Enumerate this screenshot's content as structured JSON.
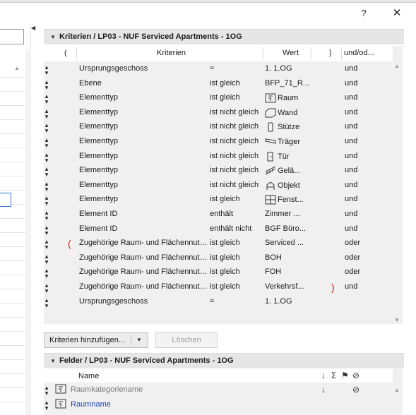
{
  "window": {
    "help_label": "?",
    "close_label": "✕"
  },
  "criteria_section": {
    "title": "Kriterien / LP03 - NUF Serviced Apartments - 1OG",
    "columns": {
      "open_paren": "(",
      "criteria": "Kriterien",
      "value": "Wert",
      "close_paren": ")",
      "and_or": "und/od..."
    },
    "rows": [
      {
        "open": "",
        "criterion": "Ursprungsgeschoss",
        "operator": "=",
        "icon": "",
        "value": "1. 1.OG",
        "close": "",
        "and_or": "und"
      },
      {
        "open": "",
        "criterion": "Ebene",
        "operator": "ist gleich",
        "icon": "",
        "value": "BFP_71_R...",
        "close": "",
        "and_or": "und"
      },
      {
        "open": "",
        "criterion": "Elementtyp",
        "operator": "ist gleich",
        "icon": "zone-icon",
        "value": "Raum",
        "close": "",
        "and_or": "und"
      },
      {
        "open": "",
        "criterion": "Elementtyp",
        "operator": "ist nicht gleich",
        "icon": "wall-icon",
        "value": "Wand",
        "close": "",
        "and_or": "und"
      },
      {
        "open": "",
        "criterion": "Elementtyp",
        "operator": "ist nicht gleich",
        "icon": "column-icon",
        "value": "Stütze",
        "close": "",
        "and_or": "und"
      },
      {
        "open": "",
        "criterion": "Elementtyp",
        "operator": "ist nicht gleich",
        "icon": "beam-icon",
        "value": "Träger",
        "close": "",
        "and_or": "und"
      },
      {
        "open": "",
        "criterion": "Elementtyp",
        "operator": "ist nicht gleich",
        "icon": "door-icon",
        "value": "Tür",
        "close": "",
        "and_or": "und"
      },
      {
        "open": "",
        "criterion": "Elementtyp",
        "operator": "ist nicht gleich",
        "icon": "railing-icon",
        "value": "Gelä...",
        "close": "",
        "and_or": "und"
      },
      {
        "open": "",
        "criterion": "Elementtyp",
        "operator": "ist nicht gleich",
        "icon": "object-icon",
        "value": "Objekt",
        "close": "",
        "and_or": "und"
      },
      {
        "open": "",
        "criterion": "Elementtyp",
        "operator": "ist gleich",
        "icon": "window-icon",
        "value": "Fenst...",
        "close": "",
        "and_or": "und"
      },
      {
        "open": "",
        "criterion": "Element ID",
        "operator": "enthält",
        "icon": "",
        "value": "Zimmer ...",
        "close": "",
        "and_or": "und"
      },
      {
        "open": "",
        "criterion": "Element ID",
        "operator": "enthält nicht",
        "icon": "",
        "value": "BGF Büro...",
        "close": "",
        "and_or": "und"
      },
      {
        "open": "(",
        "criterion": "Zugehörige Raum- und Flächennutzu...",
        "operator": "ist gleich",
        "icon": "",
        "value": "Serviced ...",
        "close": "",
        "and_or": "oder"
      },
      {
        "open": "",
        "criterion": "Zugehörige Raum- und Flächennutzu...",
        "operator": "ist gleich",
        "icon": "",
        "value": "BOH",
        "close": "",
        "and_or": "oder"
      },
      {
        "open": "",
        "criterion": "Zugehörige Raum- und Flächennutzu...",
        "operator": "ist gleich",
        "icon": "",
        "value": "FOH",
        "close": "",
        "and_or": "oder"
      },
      {
        "open": "",
        "criterion": "Zugehörige Raum- und Flächennutzu...",
        "operator": "ist gleich",
        "icon": "",
        "value": "Verkehrsf...",
        "close": ")",
        "and_or": "und"
      },
      {
        "open": "",
        "criterion": "Ursprungsgeschoss",
        "operator": "=",
        "icon": "",
        "value": "1. 1.OG",
        "close": "",
        "and_or": ""
      }
    ]
  },
  "buttons": {
    "add_criteria": "Kriterien hinzufügen...",
    "delete": "Löschen"
  },
  "fields_section": {
    "title": "Felder / LP03 - NUF Serviced Apartments - 1OG",
    "columns": {
      "name": "Name",
      "sort": "↓",
      "sum": "Σ",
      "flag": "⚑",
      "hide": "⊘"
    },
    "rows": [
      {
        "name": "Raumkategoriename",
        "color": "#7a7a7a",
        "sort": "↓",
        "hide": "⊘"
      },
      {
        "name": "Raumname",
        "color": "#1a3fb5",
        "sort": "",
        "hide": ""
      }
    ]
  },
  "colors": {
    "paren_red": "#d81b1b",
    "link_blue": "#1a3fb5",
    "header_gray": "#e6e6e6",
    "table_bg": "#f0f0f0"
  }
}
